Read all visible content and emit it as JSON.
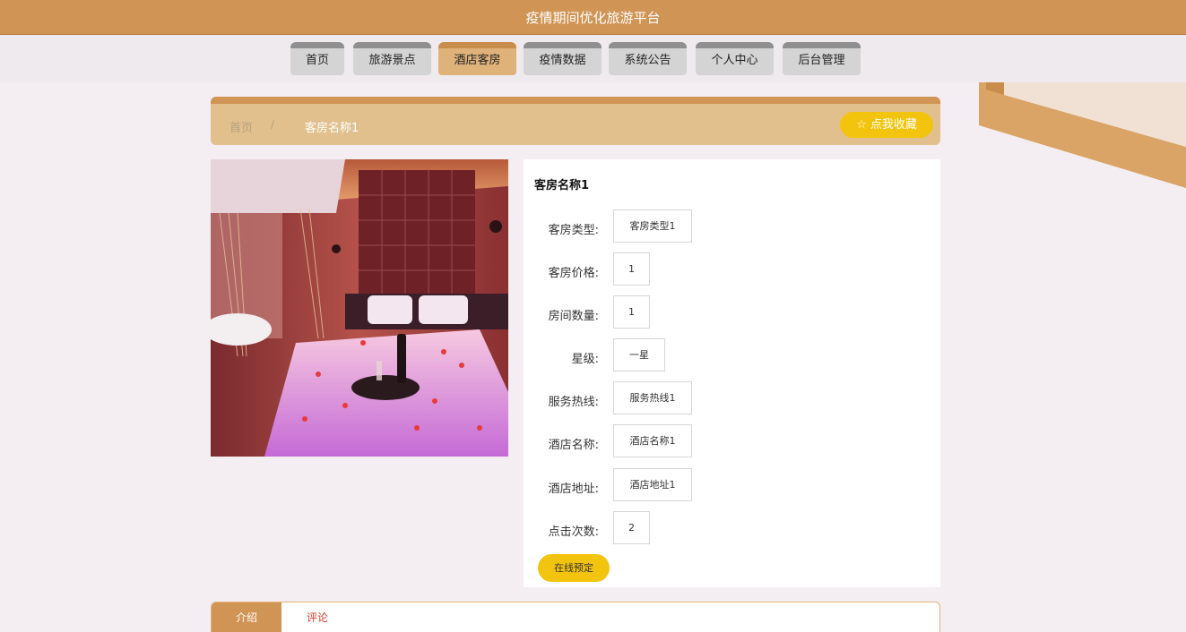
{
  "app": {
    "title": "疫情期间优化旅游平台"
  },
  "nav": {
    "items": [
      {
        "label": "首页"
      },
      {
        "label": "旅游景点"
      },
      {
        "label": "酒店客房"
      },
      {
        "label": "疫情数据"
      },
      {
        "label": "系统公告"
      },
      {
        "label": "个人中心"
      },
      {
        "label": "后台管理"
      }
    ],
    "active": "酒店客房"
  },
  "breadcrumb": {
    "home": "首页",
    "separator": "/",
    "current": "客房名称1"
  },
  "favorite_button": "☆ 点我收藏",
  "detail": {
    "name": "客房名称1",
    "fields": [
      {
        "label": "客房类型:",
        "value": "客房类型1"
      },
      {
        "label": "客房价格:",
        "value": "1"
      },
      {
        "label": "房间数量:",
        "value": "1"
      },
      {
        "label": "星级:",
        "value": "一星"
      },
      {
        "label": "服务热线:",
        "value": "服务热线1"
      },
      {
        "label": "酒店名称:",
        "value": "酒店名称1"
      },
      {
        "label": "酒店地址:",
        "value": "酒店地址1"
      },
      {
        "label": "点击次数:",
        "value": "2"
      }
    ],
    "book_button": "在线预定"
  },
  "tabs": [
    {
      "label": "介绍"
    },
    {
      "label": "评论"
    }
  ],
  "colors": {
    "brand": "#d09455",
    "accent_yellow": "#f3c40d",
    "tab_text": "#e03c28"
  }
}
